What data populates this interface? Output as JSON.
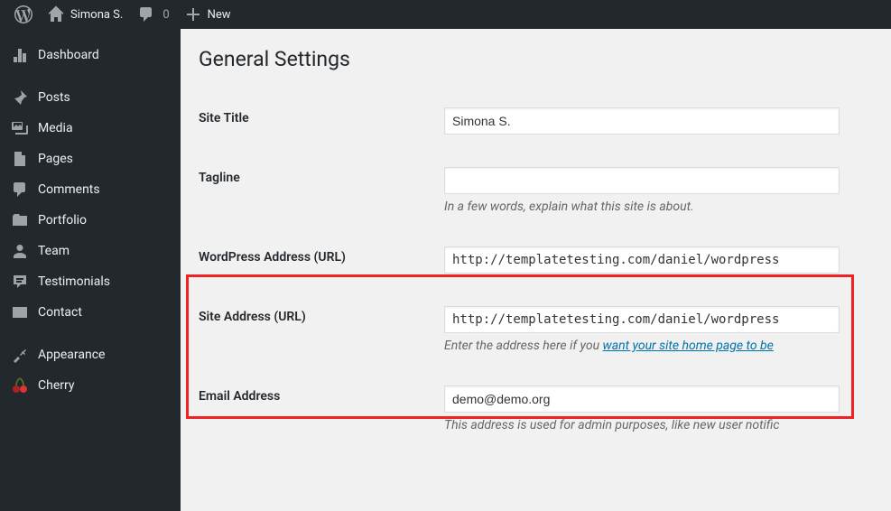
{
  "toolbar": {
    "site_name": "Simona S.",
    "comment_count": "0",
    "new_label": "New"
  },
  "sidebar": {
    "items": [
      {
        "icon": "dashboard",
        "label": "Dashboard",
        "name": "dashboard"
      },
      {
        "sep": true
      },
      {
        "icon": "pin",
        "label": "Posts",
        "name": "posts"
      },
      {
        "icon": "media",
        "label": "Media",
        "name": "media"
      },
      {
        "icon": "page",
        "label": "Pages",
        "name": "pages"
      },
      {
        "icon": "comment",
        "label": "Comments",
        "name": "comments"
      },
      {
        "icon": "portfolio",
        "label": "Portfolio",
        "name": "portfolio"
      },
      {
        "icon": "team",
        "label": "Team",
        "name": "team"
      },
      {
        "icon": "testimonial",
        "label": "Testimonials",
        "name": "testimonials"
      },
      {
        "icon": "contact",
        "label": "Contact",
        "name": "contact"
      },
      {
        "sep": true
      },
      {
        "icon": "appearance",
        "label": "Appearance",
        "name": "appearance"
      },
      {
        "icon": "cherry",
        "label": "Cherry",
        "name": "cherry"
      }
    ]
  },
  "page": {
    "title": "General Settings",
    "fields": {
      "site_title": {
        "label": "Site Title",
        "value": "Simona S."
      },
      "tagline": {
        "label": "Tagline",
        "value": "",
        "desc": "In a few words, explain what this site is about."
      },
      "wp_url": {
        "label": "WordPress Address (URL)",
        "value": "http://templatetesting.com/daniel/wordpress"
      },
      "site_url": {
        "label": "Site Address (URL)",
        "value": "http://templatetesting.com/daniel/wordpress",
        "desc_pre": "Enter the address here if you ",
        "desc_link": "want your site home page to be"
      },
      "email": {
        "label": "Email Address",
        "value": "demo@demo.org",
        "desc": "This address is used for admin purposes, like new user notific"
      }
    }
  }
}
